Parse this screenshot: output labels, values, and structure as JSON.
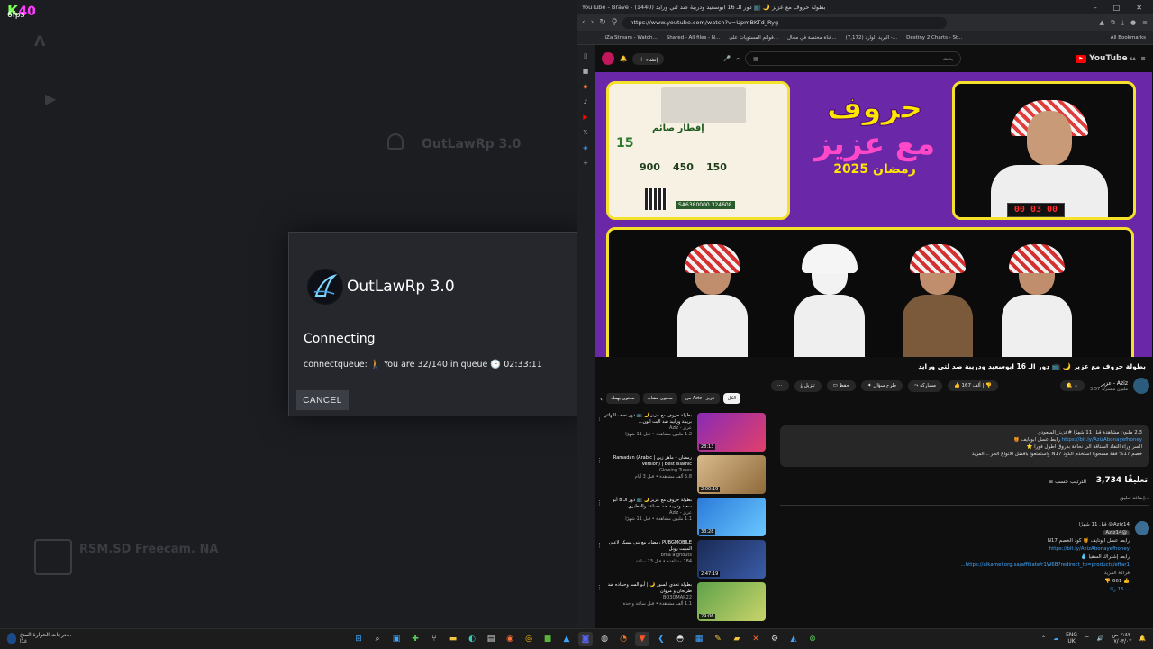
{
  "overlay": {
    "k": "K",
    "fps_value": "40",
    "fps_label": "6fps"
  },
  "launcher": {
    "server_name": "OutLawRp 3.0",
    "dialog": {
      "title": "OutLawRp 3.0",
      "status": "Connecting",
      "queue_text": "connectqueue: 🚶 You are 32/140 in queue 🕒 02:33:11",
      "cancel_label": "CANCEL"
    },
    "bg_card_title": "RSM.SD Freecam. NA"
  },
  "browser": {
    "window_title": "YouTube - Brave - (1440) بطولة حروف مع عزيز 🌙 📺 دور الـ 16 ابوسعيد ودريبة ضد لتي ورايد",
    "url": "https://www.youtube.com/watch?v=UpmBKTd_Ryg",
    "bookmarks": [
      "iiZa Stream - Watch...",
      "Shared - All files - N...",
      "قوائم المستويات على...",
      "قناة مختصة في مجال...",
      "(7,172) البريد الوارد -...",
      "Destiny 2 Charts - St..."
    ],
    "all_bookmarks": "All Bookmarks",
    "controls": {
      "min": "–",
      "max": "□",
      "close": "✕"
    }
  },
  "youtube": {
    "logo_text": "YouTube",
    "logo_sup": "SA",
    "search_placeholder": "بحث",
    "create_label": "إنشاء",
    "video": {
      "poster_header": "إفطار صائم",
      "poster_num1": "900",
      "poster_num2": "450",
      "poster_num3": "150",
      "poster_code": "SA6380000 324608",
      "poster_badge": "15",
      "art_line1": "حروف",
      "art_line2": "مع عزيز",
      "art_line3": "رمضان 2025",
      "timer": "00 03 00"
    },
    "title": "بطولة حروف مع عزيز 🌙 📺 دور الـ 16 ابوسعيد ودريبة ضد لتي ورايد",
    "channel": {
      "name": "عزيز - Aziz",
      "subs": "3.57 مليون مشترك"
    },
    "actions": {
      "likes": "167 ألف",
      "share": "مشاركة",
      "ask": "طرح سؤال",
      "save": "حفظ",
      "download": "تنزيل"
    },
    "description": {
      "line1": "2.3 مليون مشاهدة قبل 11 شهرًا #عزيز_السعودي",
      "link1": "https://bit.ly/AzizAbonayefhoney",
      "line2": "رابط عسل ابونايف 🍯",
      "line3": "السر وراء التفاد الشتاقة الى نحافة بدروق اطول فورا ⭐",
      "line4": "خصم 17% فقة مسحوبا استخدم الكود N17 واستمتعوا بافضل الانواع الحر ...المزيد"
    },
    "comments_count": "3,734 تعليقًا",
    "sort_label": "الترتيب حسب",
    "add_comment": "إضافة تعليق...",
    "comment": {
      "author": "Aziz14@ قبل 11 شهرًا",
      "tag": "@Aziz14",
      "line1": "رابط عسل ابونايف 🍯 كود الخصم N17",
      "link1": "https://bit.ly/AzizAbonayefhoney",
      "line2": "رابط إشتراك السقيا 💧",
      "link2": "https://alkamel.org.sa/affiliate/r1W6B?redirect_to=products/eftar1...",
      "more": "قراءة المزيد",
      "likes": "661",
      "replies": "15 ردًا"
    },
    "chips": [
      "الكل",
      "من Aziz - عزيز",
      "محتوى مشابه",
      "محتوى يهمك"
    ],
    "related": [
      {
        "title": "بطولة حروف مع عزيز 🌙 📺 دور نصف النهائي بريمة ورابيد ضد البت ابون...",
        "channel": "عزيز - Aziz",
        "meta": "1.2 مليون مشاهدة • قبل 11 شهرًا",
        "duration": "28:13"
      },
      {
        "title": "رمضان – ماهر زين | Ramadan (Arabic Version) | Best Islamic",
        "channel": "Glowing Tunes",
        "meta": "5.8 ألف مشاهدة • قبل 3 أيام",
        "duration": "2:00:19"
      },
      {
        "title": "بطولة حروف مع عزيز 🌙 📺 دور الـ 8 أبو سعيد ودريبة ضد مساعد والعطيري",
        "channel": "عزيز - Aziz",
        "meta": "1.1 مليون مشاهدة • قبل 11 شهرًا",
        "duration": "33:28"
      },
      {
        "title": "PUBGMOBILE رمضان مع بني مسكر لاعبي المبيت روبل",
        "channel": "bma alghouts",
        "meta": "184 مشاهدة • قبل 23 ساعة",
        "duration": "2:47:19"
      },
      {
        "title": "بطولة تحدي السور 🌙 | أبو السد وحماده ضد طريجان و مروان",
        "channel": "BO3OMAR22",
        "meta": "1.1 ألف مشاهدة • قبل ساعة واحدة",
        "duration": "29:06"
      }
    ]
  },
  "taskbar": {
    "weather_line1": "درجات الحرارة المنخ...",
    "weather_line2": "غدًا",
    "lang_line1": "ENG",
    "lang_line2": "UK",
    "time": "٢:٤٣ ص",
    "date": "٠٧/٠٣/٠٢"
  }
}
